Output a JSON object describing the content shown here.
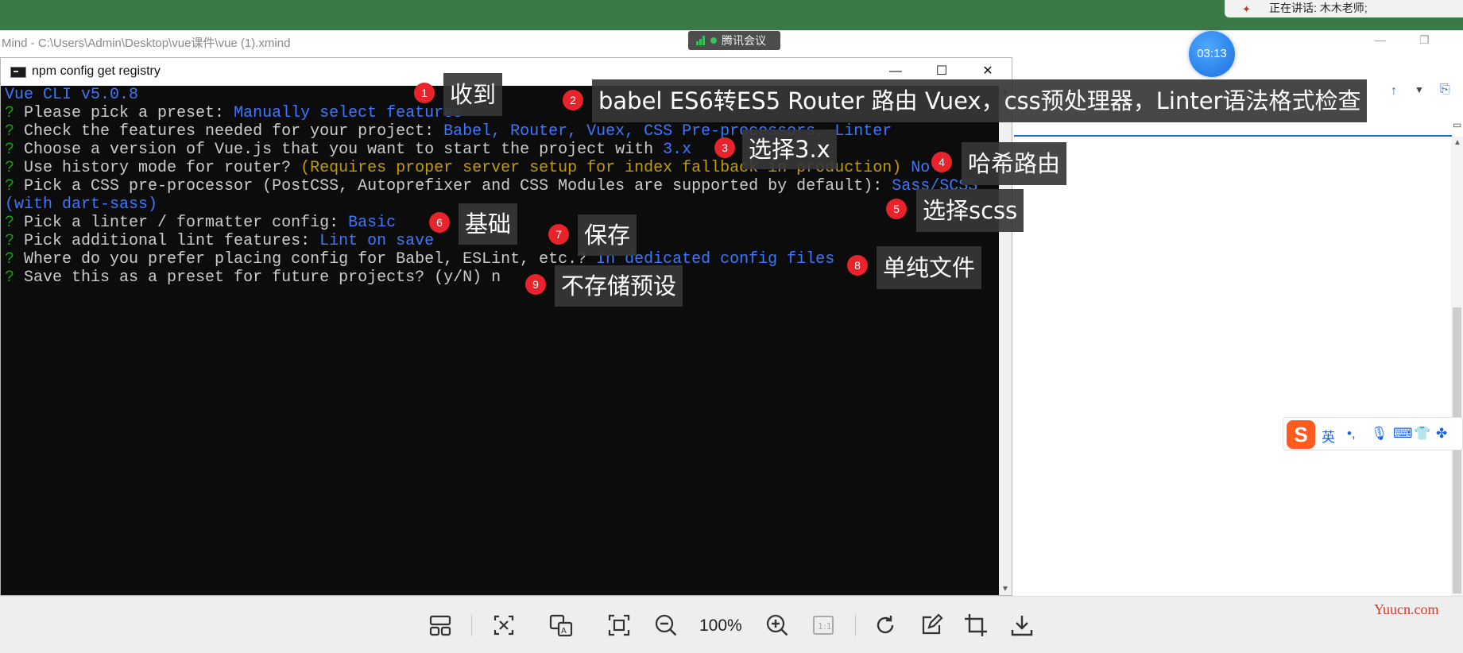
{
  "meeting": {
    "speaking": "正在讲话: 木木老师;",
    "app_name": "腾讯会议",
    "timer": "03:13"
  },
  "background_app": {
    "title": "Mind - C:\\Users\\Admin\\Desktop\\vue课件\\vue (1).xmind"
  },
  "terminal": {
    "title": "npm config get registry",
    "lines": {
      "l1": {
        "text": "Vue CLI v5.0.8"
      },
      "l2": {
        "prefix": "?",
        "prompt": " Please pick a preset: ",
        "answer": "Manually select features"
      },
      "l3": {
        "prefix": "?",
        "prompt": " Check the features needed for your project: ",
        "answer": "Babel, Router, Vuex, CSS Pre-processors, Linter"
      },
      "l4": {
        "prefix": "?",
        "prompt": " Choose a version of Vue.js that you want to start the project with ",
        "answer": "3.x"
      },
      "l5": {
        "prefix": "?",
        "prompt": " Use history mode for router? ",
        "hint": "(Requires proper server setup for index fallback in production)",
        "answer": " No"
      },
      "l6": {
        "prefix": "?",
        "prompt": " Pick a CSS pre-processor (PostCSS, Autoprefixer and CSS Modules are supported by default): ",
        "answer": "Sass/SCSS"
      },
      "l6b": {
        "answer": "(with dart-sass)"
      },
      "l7": {
        "prefix": "?",
        "prompt": " Pick a linter / formatter config: ",
        "answer": "Basic"
      },
      "l8": {
        "prefix": "?",
        "prompt": " Pick additional lint features: ",
        "answer": "Lint on save"
      },
      "l9": {
        "prefix": "?",
        "prompt": " Where do you prefer placing config for Babel, ESLint, etc.? ",
        "answer": "In dedicated config files"
      },
      "l10": {
        "prefix": "?",
        "prompt": " Save this as a preset for future projects? (y/N) ",
        "answer": "n"
      }
    }
  },
  "annotations": [
    {
      "num": "1",
      "text": "收到"
    },
    {
      "num": "2",
      "text": "babel ES6转ES5  Router 路由 Vuex，css预处理器，Linter语法格式检查"
    },
    {
      "num": "3",
      "text": "选择3.x"
    },
    {
      "num": "4",
      "text": "哈希路由"
    },
    {
      "num": "5",
      "text": "选择scss"
    },
    {
      "num": "6",
      "text": "基础"
    },
    {
      "num": "7",
      "text": "保存"
    },
    {
      "num": "8",
      "text": "单纯文件"
    },
    {
      "num": "9",
      "text": "不存储预设"
    }
  ],
  "ime": {
    "lang": "英",
    "punct": "•,"
  },
  "viewer": {
    "zoom": "100%",
    "actual_size": "1:1"
  },
  "watermark": "Yuucn.com"
}
